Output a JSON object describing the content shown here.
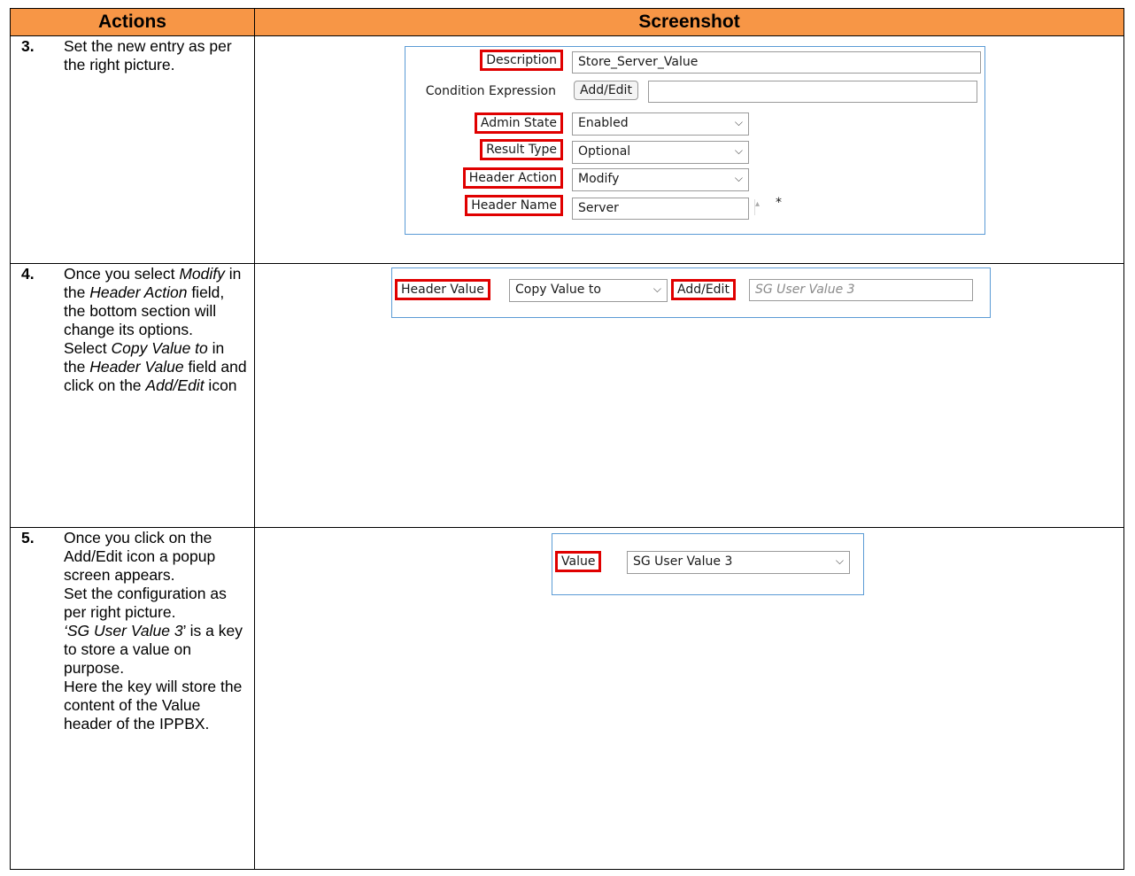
{
  "table": {
    "header_actions": "Actions",
    "header_screenshot": "Screenshot"
  },
  "steps": [
    {
      "number": "3.",
      "text_parts": [
        "Set the new entry as per the right picture."
      ]
    },
    {
      "number": "4.",
      "text": {
        "p1": "Once you select ",
        "p2": "Modify",
        "p3": " in the ",
        "p4": "Header Action",
        "p5": " field, the bottom section will change its options.",
        "p6": "Select ",
        "p7": "Copy Value to",
        "p8": " in the ",
        "p9": "Header Value",
        "p10": " field and click on the ",
        "p11": "Add/Edit",
        "p12": " icon"
      }
    },
    {
      "number": "5.",
      "text": {
        "p1": "Once you click on the Add/Edit icon a popup screen appears.",
        "p2": "Set the configuration as per right picture.",
        "p3": "‘SG User Value 3",
        "p4": "’ is a key to store  a value on purpose.",
        "p5": "Here the key will store the content of the Value header of the IPPBX."
      }
    }
  ],
  "form1": {
    "description_label": "Description",
    "description_value": "Store_Server_Value",
    "condition_label": "Condition Expression",
    "condition_button": "Add/Edit",
    "admin_state_label": "Admin State",
    "admin_state_value": "Enabled",
    "result_type_label": "Result Type",
    "result_type_value": "Optional",
    "header_action_label": "Header Action",
    "header_action_value": "Modify",
    "header_name_label": "Header Name",
    "header_name_value": "Server",
    "required_mark": "*"
  },
  "form2": {
    "header_value_label": "Header Value",
    "header_value_select": "Copy Value to",
    "add_edit_button": "Add/Edit",
    "target_placeholder": "SG User Value 3"
  },
  "form3": {
    "value_label": "Value",
    "value_select": "SG User Value 3"
  },
  "colors": {
    "header_bg": "#f79646",
    "highlight": "#e00000",
    "panel_border": "#5b9bd5"
  },
  "icons": [
    "chevron-down-icon",
    "spinner-icon"
  ]
}
